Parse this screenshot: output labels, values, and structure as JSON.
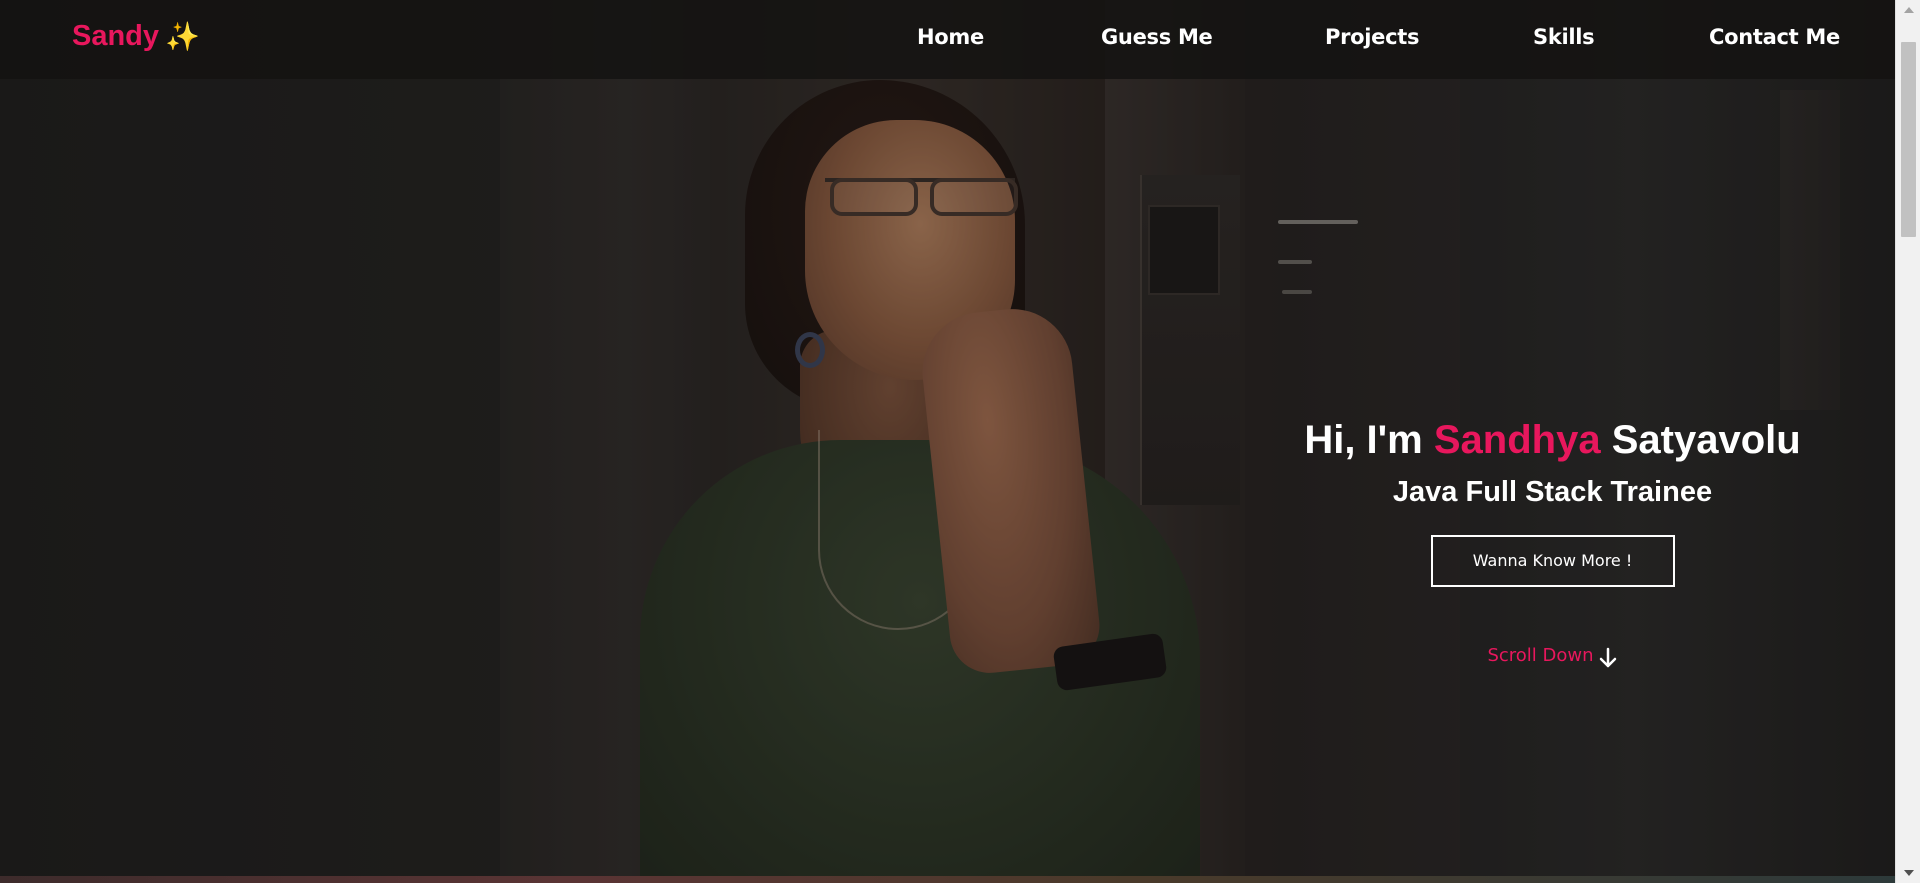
{
  "brand": {
    "name": "Sandy",
    "emoji": "✨",
    "accent_color": "#e8175d"
  },
  "nav": {
    "links": [
      {
        "label": "Home"
      },
      {
        "label": "Guess Me"
      },
      {
        "label": "Projects"
      },
      {
        "label": "Skills"
      },
      {
        "label": "Contact Me"
      }
    ]
  },
  "hero": {
    "greeting_prefix": "Hi, I'm",
    "first_name": "Sandhya",
    "last_name": "Satyavolu",
    "subtitle": "Java Full Stack Trainee",
    "cta_label": "Wanna Know More !",
    "scroll_label": "Scroll Down",
    "scroll_icon": "arrow-down-icon",
    "background": "portrait-photo"
  },
  "scrollbar": {
    "up_icon": "chevron-up-icon",
    "down_icon": "chevron-down-icon"
  }
}
